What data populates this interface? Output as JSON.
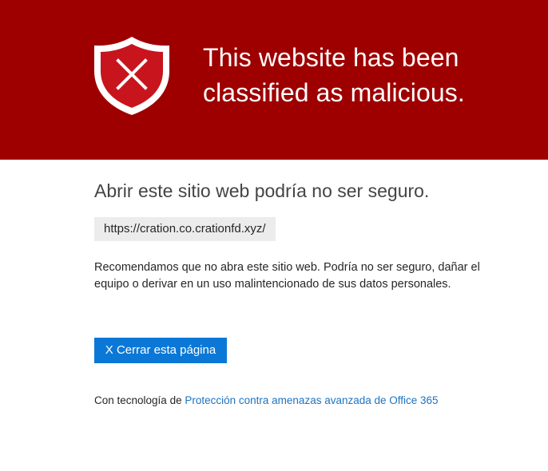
{
  "banner": {
    "title": "This website has been classified as malicious.",
    "icon": "shield-x-icon",
    "background_color": "#9e0000"
  },
  "main": {
    "heading": "Abrir este sitio web podría no ser seguro.",
    "url": "https://cration.co.crationfd.xyz/",
    "description": "Recomendamos que no abra este sitio web. Podría no ser seguro, dañar el equipo o derivar en un uso malintencionado de sus datos personales.",
    "close_button_label": "X Cerrar esta página",
    "accent_color": "#0b78d7"
  },
  "footer": {
    "prefix": "Con tecnología de",
    "link_text": "Protección contra amenazas avanzada de Office 365"
  }
}
